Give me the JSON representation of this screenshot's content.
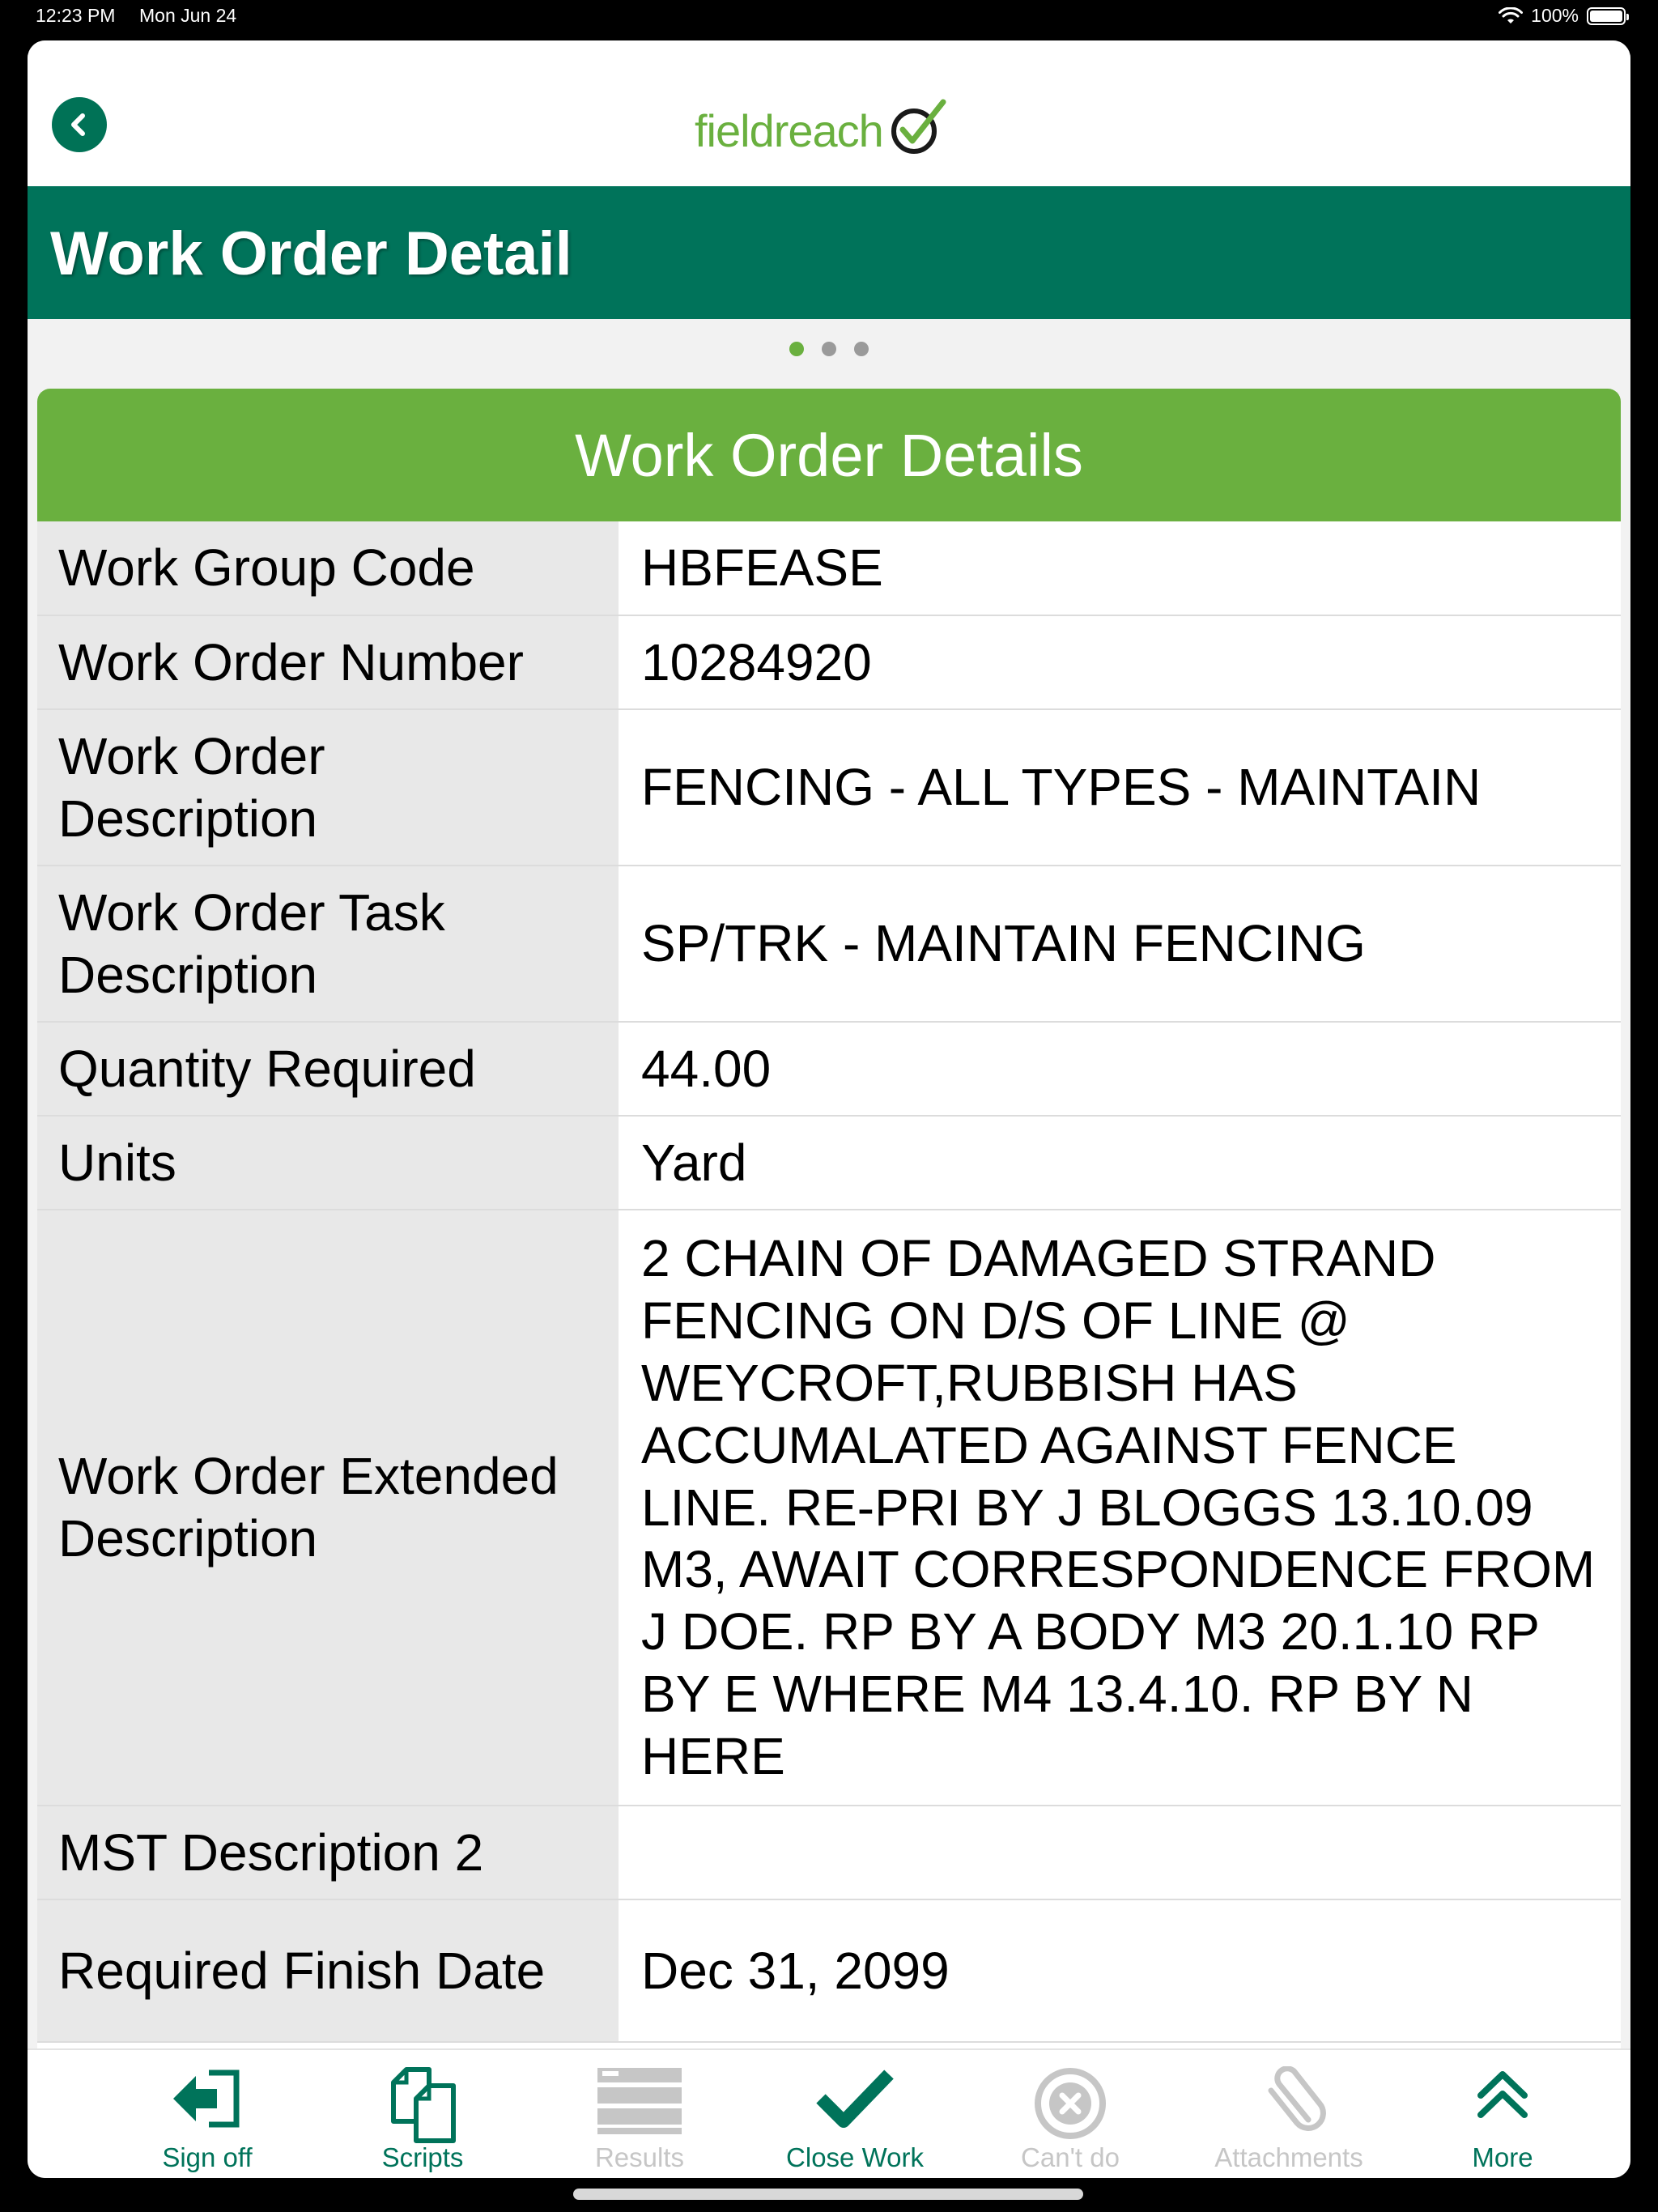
{
  "status_bar": {
    "time": "12:23 PM",
    "date": "Mon Jun 24",
    "battery": "100%"
  },
  "header": {
    "logo": "fieldreach",
    "title": "Work Order Detail"
  },
  "pager": {
    "pages": 3,
    "active_page": 1
  },
  "section": {
    "title": "Work Order Details",
    "rows": [
      {
        "label": "Work Group Code",
        "value": "HBFEASE"
      },
      {
        "label": "Work Order Number",
        "value": "10284920"
      },
      {
        "label": "Work Order Description",
        "value": "FENCING - ALL TYPES - MAINTAIN"
      },
      {
        "label": "Work Order Task Description",
        "value": "SP/TRK - MAINTAIN FENCING"
      },
      {
        "label": "Quantity Required",
        "value": "44.00"
      },
      {
        "label": "Units",
        "value": "Yard"
      },
      {
        "label": "Work Order Extended Description",
        "value": "2 CHAIN OF DAMAGED STRAND FENCING ON D/S OF LINE @ WEYCROFT,RUBBISH HAS ACCUMALATED AGAINST FENCE LINE. RE-PRI BY J BLOGGS 13.10.09 M3, AWAIT CORRESPONDENCE FROM J DOE. RP BY A BODY M3 20.1.10 RP BY E WHERE M4 13.4.10. RP BY N HERE"
      },
      {
        "label": "MST Description 2",
        "value": ""
      },
      {
        "label": "Required Finish Date",
        "value": "Dec 31, 2099"
      }
    ]
  },
  "tabbar": {
    "items": [
      {
        "label": "Sign off",
        "icon": "sign-off-icon",
        "enabled": true
      },
      {
        "label": "Scripts",
        "icon": "scripts-icon",
        "enabled": true
      },
      {
        "label": "Results",
        "icon": "results-icon",
        "enabled": false
      },
      {
        "label": "Close Work",
        "icon": "checkmark-icon",
        "enabled": true
      },
      {
        "label": "Can't do",
        "icon": "cancel-icon",
        "enabled": false
      },
      {
        "label": "Attachments",
        "icon": "paperclip-icon",
        "enabled": false
      },
      {
        "label": "More",
        "icon": "chevron-up-double-icon",
        "enabled": true
      }
    ]
  },
  "colors": {
    "primary": "#00735A",
    "accent": "#6AB03F",
    "disabled": "#C6C6C6"
  }
}
